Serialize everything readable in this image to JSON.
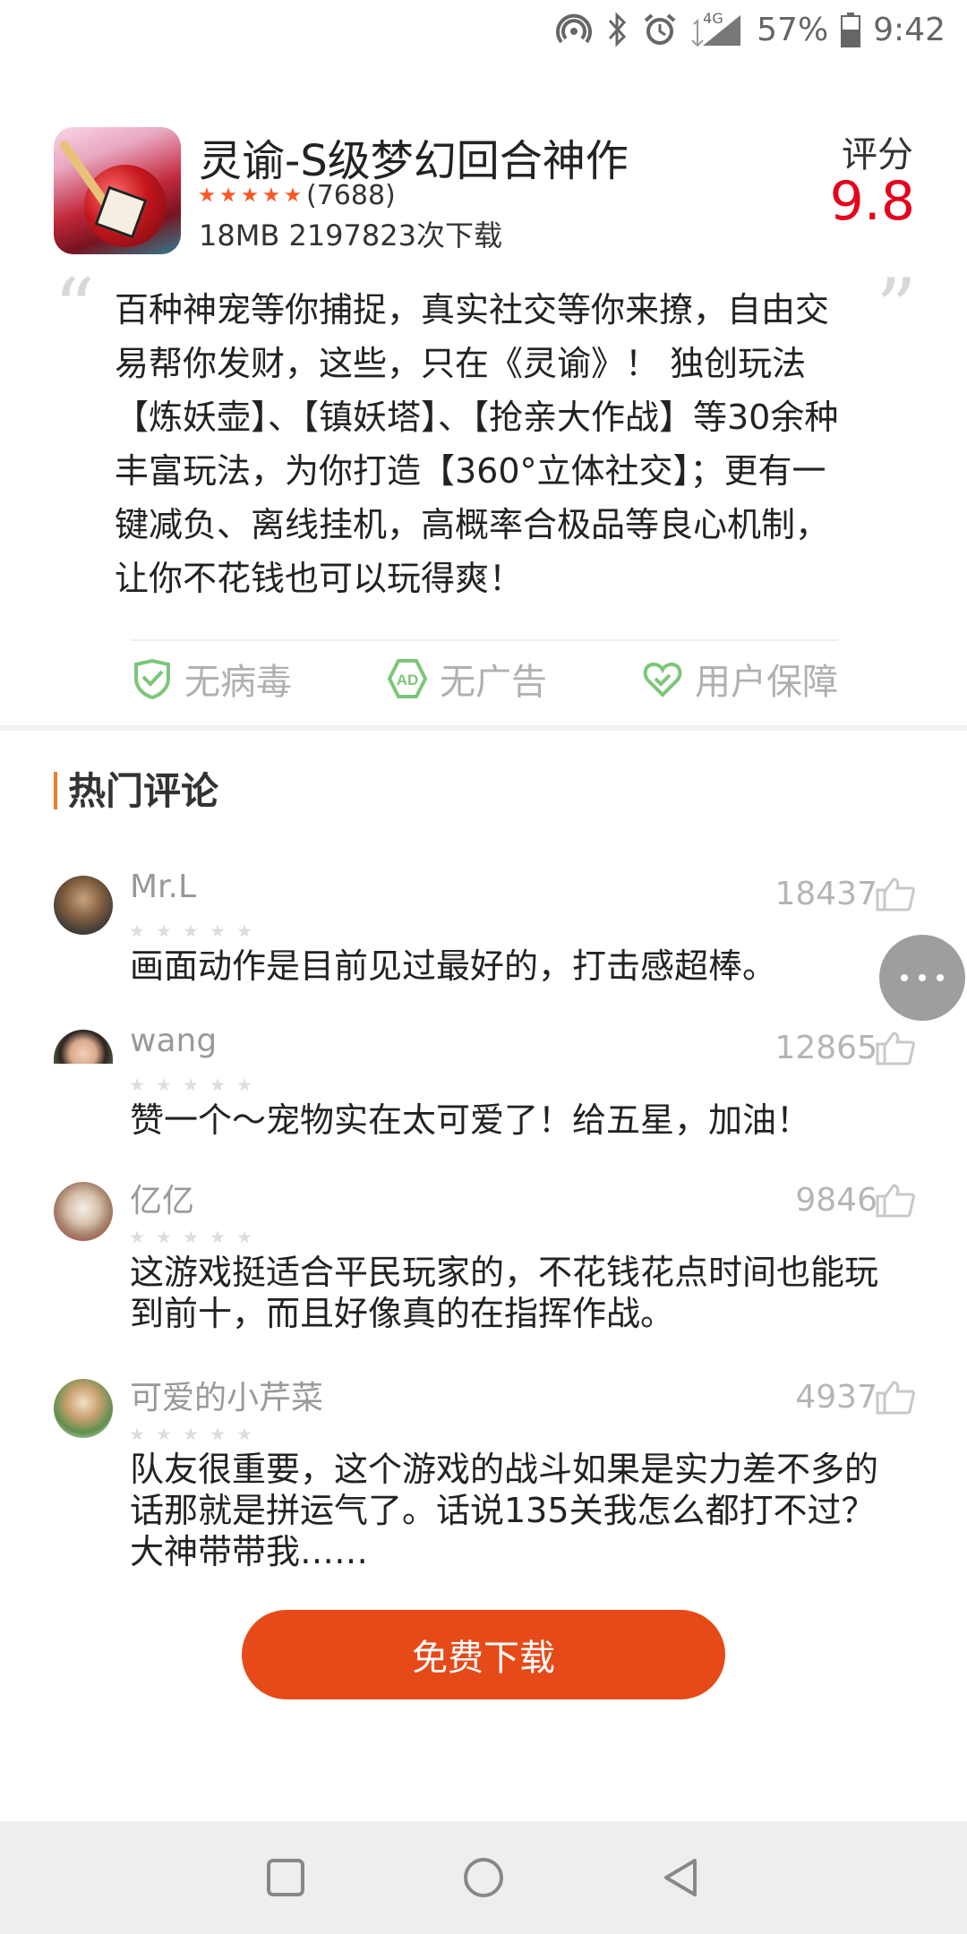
{
  "status_bar": {
    "network": "4G",
    "battery": "57%",
    "time": "9:42"
  },
  "app": {
    "title": "灵谕-S级梦幻回合神作",
    "rating_count": "(7688)",
    "meta": "18MB 2197823次下载",
    "score_label": "评分",
    "score": "9.8",
    "stars": 5
  },
  "description": "百种神宠等你捕捉，真实社交等你来撩，自由交易帮你发财，这些，只在《灵谕》！ 独创玩法【炼妖壶】、【镇妖塔】、【抢亲大作战】等30余种丰富玩法，为你打造【360°立体社交】；更有一键减负、离线挂机，高概率合极品等良心机制，让你不花钱也可以玩得爽！",
  "guarantees": [
    {
      "label": "无病毒",
      "icon": "shield-check-icon"
    },
    {
      "label": "无广告",
      "icon": "ad-badge-icon"
    },
    {
      "label": "用户保障",
      "icon": "heart-hand-icon"
    }
  ],
  "comments_section": {
    "title": "热门评论",
    "comments": [
      {
        "user": "Mr.L",
        "likes": "18437",
        "text": "画面动作是目前见过最好的，打击感超棒。"
      },
      {
        "user": "wang",
        "likes": "12865",
        "text": "赞一个～宠物实在太可爱了！给五星，加油！"
      },
      {
        "user": "亿亿",
        "likes": "9846",
        "text": "这游戏挺适合平民玩家的，不花钱花点时间也能玩到前十，而且好像真的在指挥作战。"
      },
      {
        "user": "可爱的小芹菜",
        "likes": "4937",
        "text": "队友很重要，这个游戏的战斗如果是实力差不多的话那就是拼运气了。话说135关我怎么都打不过？大神带带我……"
      }
    ]
  },
  "download_button": "免费下载",
  "colors": {
    "score": "#e5001c",
    "star": "#ff5722",
    "accent": "#e64a19",
    "section_bar": "#e8802a",
    "guarantee_green": "#7cc67a"
  }
}
